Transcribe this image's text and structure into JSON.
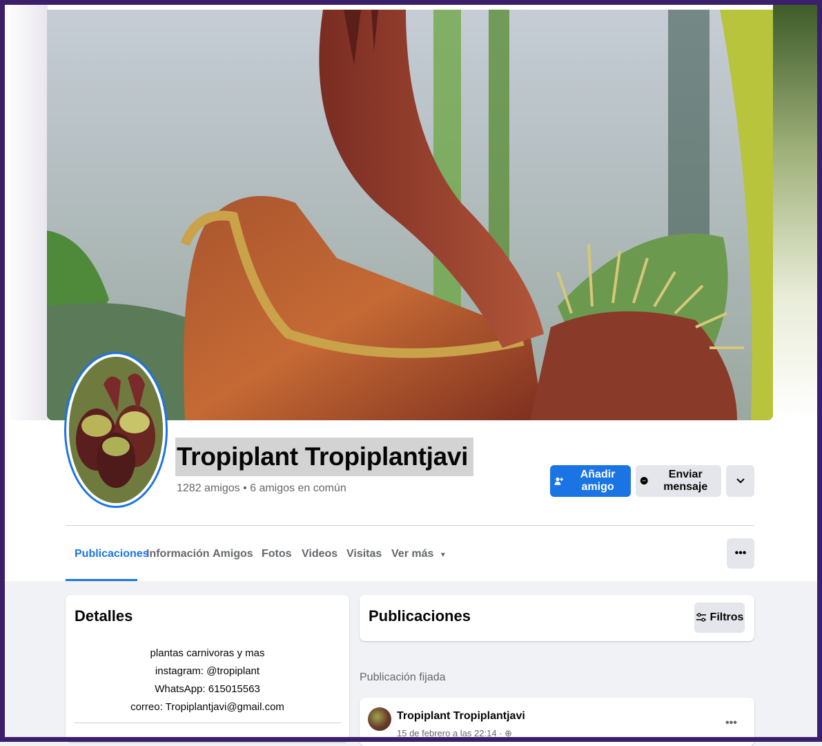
{
  "profile": {
    "name": "Tropiplant Tropiplantjavi",
    "friends_summary": "1282 amigos • 6 amigos en común"
  },
  "actions": {
    "add_friend_label": "Añadir amigo",
    "send_message_label": "Enviar mensaje",
    "more_icon": "chevron-down-icon"
  },
  "tabs": [
    {
      "label": "Publicaciones",
      "active": true
    },
    {
      "label": "Información",
      "active": false
    },
    {
      "label": "Amigos",
      "active": false
    },
    {
      "label": "Fotos",
      "active": false
    },
    {
      "label": "Videos",
      "active": false
    },
    {
      "label": "Visitas",
      "active": false
    },
    {
      "label": "Ver más",
      "active": false
    }
  ],
  "details": {
    "title": "Detalles",
    "bio_lines": [
      "plantas carnivoras y mas",
      "instagram: @tropiplant",
      "WhatsApp: 615015563",
      "correo: Tropiplantjavi@gmail.com"
    ]
  },
  "posts": {
    "title": "Publicaciones",
    "filter_label": "Filtros",
    "pinned_label": "Publicación fijada",
    "pinned_post": {
      "author": "Tropiplant Tropiplantjavi",
      "time": "15 de febrero a las 22:14 · "
    }
  },
  "colors": {
    "accent": "#1b74e4",
    "frame": "#3b1f6b",
    "highlight": "#d3d3d3"
  }
}
